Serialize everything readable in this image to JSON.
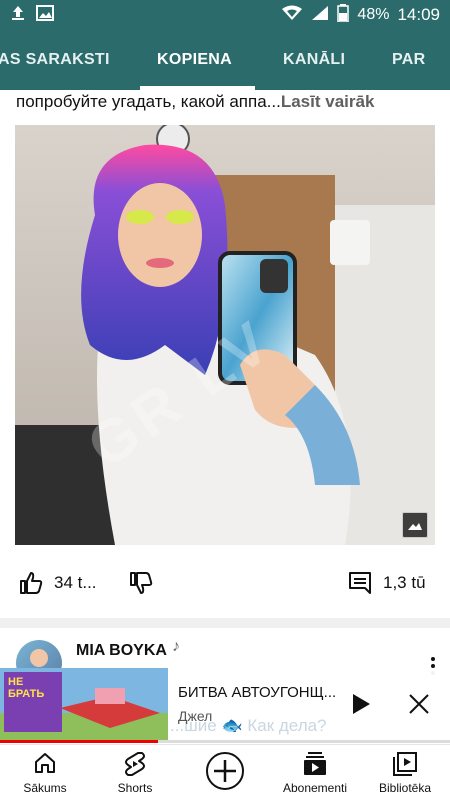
{
  "status_bar": {
    "battery": "48%",
    "time": "14:09"
  },
  "tabs": [
    {
      "label": "AS SARAKSTI"
    },
    {
      "label": "KOPIENA"
    },
    {
      "label": "KANĀLI"
    },
    {
      "label": "PAR"
    }
  ],
  "post": {
    "text": "попробуйте угадать, какой аппа...",
    "read_more": "Lasīt vairāk",
    "watermark": "GR LV"
  },
  "actions": {
    "likes": "34 t...",
    "comments": "1,3 tū"
  },
  "next_post": {
    "author": "MIA BOYKA",
    "partial_text": "...шие 🐟 Как дела?"
  },
  "mini_player": {
    "title": "БИТВА АВТОУГОНЩ...",
    "artist": "Джел",
    "thumb_text": "НЕ БРАТЬ",
    "progress": 0.35
  },
  "bottom_nav": [
    {
      "label": "Sākums",
      "icon": "home-icon"
    },
    {
      "label": "Shorts",
      "icon": "shorts-icon"
    },
    {
      "label": "",
      "icon": "create-icon"
    },
    {
      "label": "Abonementi",
      "icon": "subscriptions-icon"
    },
    {
      "label": "Bibliotēka",
      "icon": "library-icon"
    }
  ],
  "colors": {
    "accent": "#2b6b6b",
    "progress": "#ee0000"
  }
}
